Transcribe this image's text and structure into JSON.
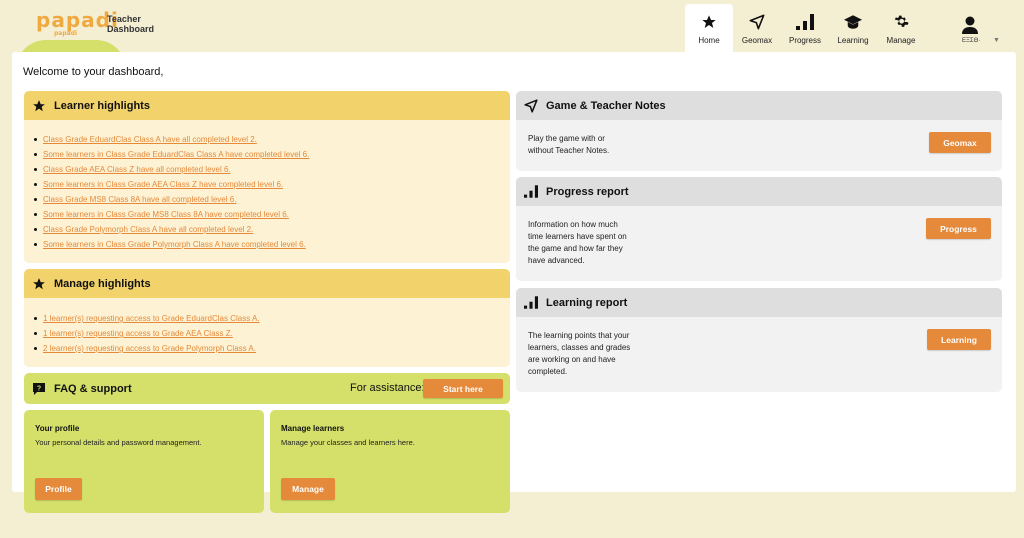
{
  "header": {
    "logo_text": "papadi",
    "logo_sub": "papadi",
    "subtitle": "Teacher Dashboard",
    "nav": [
      {
        "label": "Home",
        "icon": "star-icon",
        "active": true
      },
      {
        "label": "Geomax",
        "icon": "paper-plane-icon",
        "active": false
      },
      {
        "label": "Progress",
        "icon": "bar-chart-icon",
        "active": false
      },
      {
        "label": "Learning",
        "icon": "graduation-cap-icon",
        "active": false
      },
      {
        "label": "Manage",
        "icon": "gear-icon",
        "active": false
      }
    ],
    "user_name": "ΕΞΣΘ·"
  },
  "main": {
    "welcome": "Welcome to your dashboard,",
    "learner_highlights": {
      "title": "Learner highlights",
      "items": [
        "Class Grade EduardClas Class A have all completed level 2.",
        "Some learners in Class Grade EduardClas Class A have completed level 6.",
        "Class Grade AEA Class Z have all completed level 6.",
        "Some learners in Class Grade AEA Class Z have completed level 6.",
        "Class Grade MS8 Class 8A have all completed level 6.",
        "Some learners in Class Grade MS8 Class 8A have completed level 6.",
        "Class Grade Polymorph Class A have all completed level 2.",
        "Some learners in Class Grade Polymorph Class A have completed level 6."
      ]
    },
    "manage_highlights": {
      "title": "Manage highlights",
      "items": [
        "1 learner(s) requesting access to Grade EduardClas Class A.",
        "1 learner(s) requesting access to Grade AEA Class Z.",
        "2 learner(s) requesting access to Grade Polymorph Class A."
      ]
    },
    "faq": {
      "title": "FAQ & support",
      "assist_label": "For assistance:",
      "button": "Start here"
    },
    "profile_tile": {
      "title": "Your profile",
      "desc": "Your personal details and password management.",
      "button": "Profile"
    },
    "manage_tile": {
      "title": "Manage learners",
      "desc": "Manage your classes and learners here.",
      "button": "Manage"
    },
    "game_notes": {
      "title": "Game & Teacher Notes",
      "desc_line1": "Play the game with or",
      "desc_line2": "without Teacher Notes.",
      "button": "Geomax"
    },
    "progress_report": {
      "title": "Progress report",
      "desc": [
        "Information on how much",
        "time learners have spent on",
        "the game and how far they",
        "have advanced."
      ],
      "button": "Progress"
    },
    "learning_report": {
      "title": "Learning report",
      "desc": [
        "The learning points that your",
        "learners, classes and grades",
        "are working on and have",
        "completed."
      ],
      "button": "Learning"
    }
  },
  "colors": {
    "background": "#f4eed3",
    "accent_orange": "#e5893a",
    "highlight_yellow": "#f2d26a",
    "green": "#d4e06a"
  }
}
